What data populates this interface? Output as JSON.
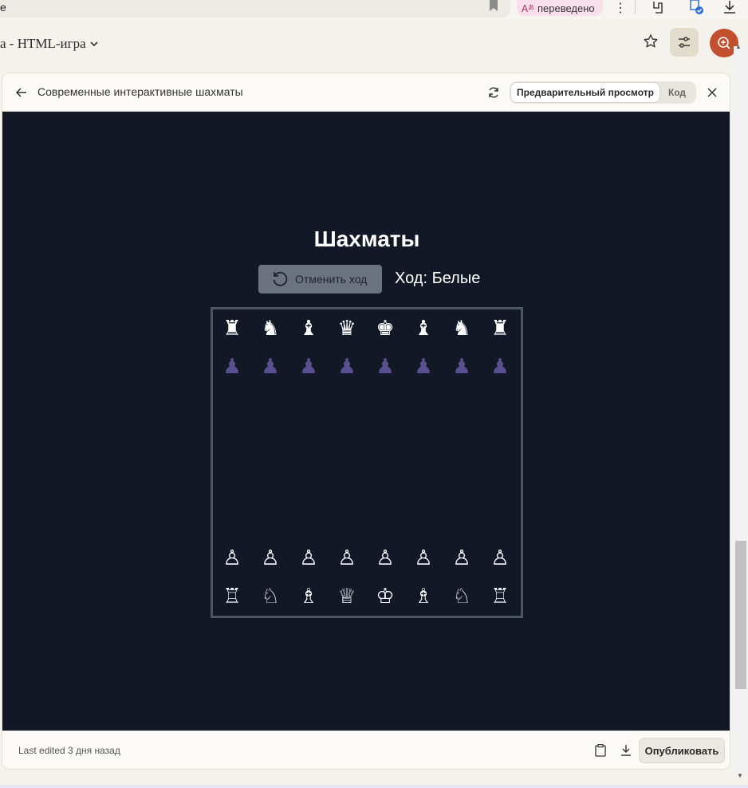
{
  "browser": {
    "url_fragment": "e",
    "translate_label": "переведено"
  },
  "app": {
    "project_title": "а - HTML-игра"
  },
  "artifact": {
    "title": "Современные интерактивные шахматы",
    "tabs": [
      {
        "label": "Предварительный просмотр",
        "active": true
      },
      {
        "label": "Код",
        "active": false
      }
    ],
    "last_edited": "Last edited 3 дня назад",
    "publish_label": "Опубликовать"
  },
  "game": {
    "title": "Шахматы",
    "undo_label": "Отменить ход",
    "turn_label": "Ход: Белые",
    "board": [
      [
        "♜",
        "♞",
        "♝",
        "♛",
        "♚",
        "♝",
        "♞",
        "♜"
      ],
      [
        "♟",
        "♟",
        "♟",
        "♟",
        "♟",
        "♟",
        "♟",
        "♟"
      ],
      [
        "",
        "",
        "",
        "",
        "",
        "",
        "",
        ""
      ],
      [
        "",
        "",
        "",
        "",
        "",
        "",
        "",
        ""
      ],
      [
        "",
        "",
        "",
        "",
        "",
        "",
        "",
        ""
      ],
      [
        "",
        "",
        "",
        "",
        "",
        "",
        "",
        ""
      ],
      [
        "♙",
        "♙",
        "♙",
        "♙",
        "♙",
        "♙",
        "♙",
        "♙"
      ],
      [
        "♖",
        "♘",
        "♗",
        "♕",
        "♔",
        "♗",
        "♘",
        "♖"
      ]
    ],
    "colors": {
      "background": "#121826",
      "board_border": "#4b5563",
      "white_piece": "#ffffff",
      "purple_pawn": "#5b4f8f",
      "undo_button": "#6b7280"
    }
  }
}
